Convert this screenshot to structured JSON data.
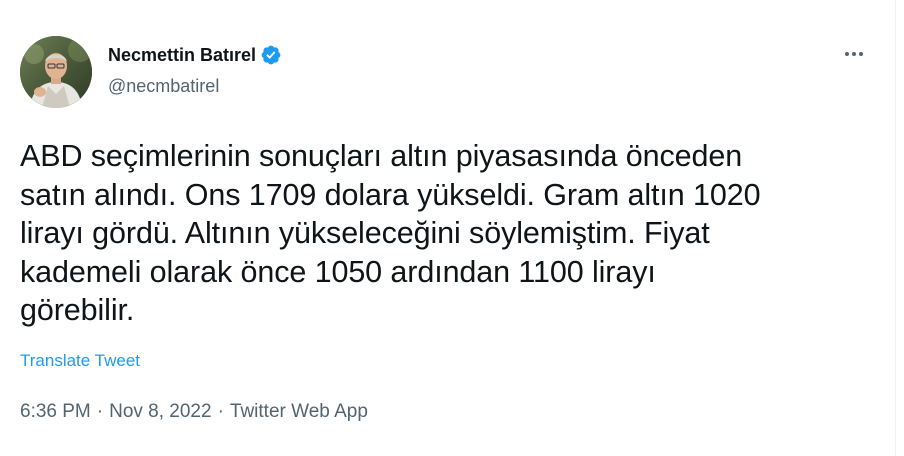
{
  "author": {
    "display_name": "Necmettin Batırel",
    "handle": "@necmbatirel",
    "verified": true,
    "avatar_icon": "user-avatar",
    "verified_color": "#1d9bf0"
  },
  "tweet": {
    "text": "ABD seçimlerinin sonuçları altın piyasasında önceden\nsatın alındı. Ons 1709 dolara yükseldi. Gram altın 1020\nlirayı gördü. Altının yükseleceğini söylemiştim. Fiyat\nkademeli olarak önce 1050 ardından 1100 lirayı\ngörebilir.",
    "translate_label": "Translate Tweet",
    "time": "6:36 PM",
    "date": "Nov 8, 2022",
    "separator": "·",
    "source": "Twitter Web App"
  },
  "menu": {
    "icon": "more-dots-icon"
  },
  "colors": {
    "text_primary": "#0f1419",
    "text_secondary": "#536471",
    "link": "#1d9bf0"
  }
}
